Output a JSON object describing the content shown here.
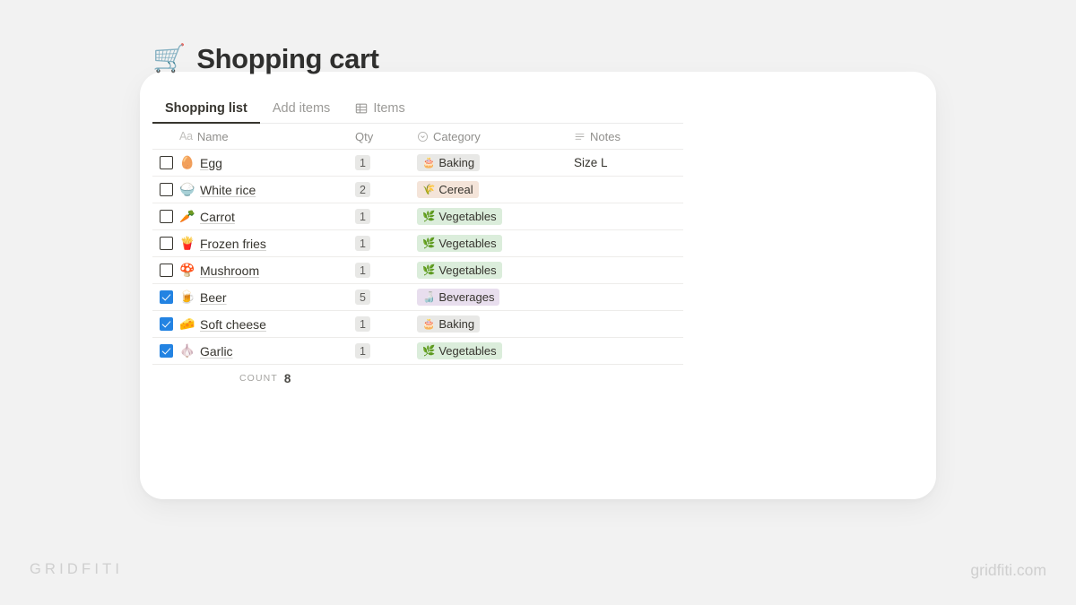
{
  "page": {
    "background_color": "#f2f2f2",
    "card_background": "#ffffff"
  },
  "header": {
    "title_emoji": "🛒",
    "title": "Shopping cart"
  },
  "tabs": [
    {
      "label": "Shopping list",
      "icon": "",
      "active": true
    },
    {
      "label": "Add items",
      "icon": "",
      "active": false
    },
    {
      "label": "Items",
      "icon": "table-icon",
      "active": false
    }
  ],
  "table": {
    "columns": [
      {
        "key": "name",
        "label": "Name",
        "icon": "aa-text-icon"
      },
      {
        "key": "qty",
        "label": "Qty",
        "icon": ""
      },
      {
        "key": "category",
        "label": "Category",
        "icon": "select-circle-icon"
      },
      {
        "key": "notes",
        "label": "Notes",
        "icon": "text-lines-icon"
      }
    ],
    "rows": [
      {
        "checked": false,
        "emoji": "🥚",
        "name": "Egg",
        "qty": "1",
        "category": "Baking",
        "category_emoji": "🎂",
        "category_color": "#e8e8e6",
        "notes": "Size L"
      },
      {
        "checked": false,
        "emoji": "🍚",
        "name": "White rice",
        "qty": "2",
        "category": "Cereal",
        "category_emoji": "🌾",
        "category_color": "#f4e4d9",
        "notes": ""
      },
      {
        "checked": false,
        "emoji": "🥕",
        "name": "Carrot",
        "qty": "1",
        "category": "Vegetables",
        "category_emoji": "🌿",
        "category_color": "#dbeddb",
        "notes": ""
      },
      {
        "checked": false,
        "emoji": "🍟",
        "name": "Frozen fries",
        "qty": "1",
        "category": "Vegetables",
        "category_emoji": "🌿",
        "category_color": "#dbeddb",
        "notes": ""
      },
      {
        "checked": false,
        "emoji": "🍄",
        "name": "Mushroom",
        "qty": "1",
        "category": "Vegetables",
        "category_emoji": "🌿",
        "category_color": "#dbeddb",
        "notes": ""
      },
      {
        "checked": true,
        "emoji": "🍺",
        "name": "Beer",
        "qty": "5",
        "category": "Beverages",
        "category_emoji": "🍶",
        "category_color": "#e8deee",
        "notes": ""
      },
      {
        "checked": true,
        "emoji": "🧀",
        "name": "Soft cheese",
        "qty": "1",
        "category": "Baking",
        "category_emoji": "🎂",
        "category_color": "#e8e8e6",
        "notes": ""
      },
      {
        "checked": true,
        "emoji": "🧄",
        "name": "Garlic",
        "qty": "1",
        "category": "Vegetables",
        "category_emoji": "🌿",
        "category_color": "#dbeddb",
        "notes": ""
      }
    ]
  },
  "footer": {
    "count_label": "COUNT",
    "count_value": "8"
  },
  "watermarks": {
    "left": "GRIDFITI",
    "right": "gridfiti.com"
  },
  "colors": {
    "checkbox_checked": "#2383e2",
    "text_primary": "#37352f",
    "text_muted": "#9b9a97"
  }
}
